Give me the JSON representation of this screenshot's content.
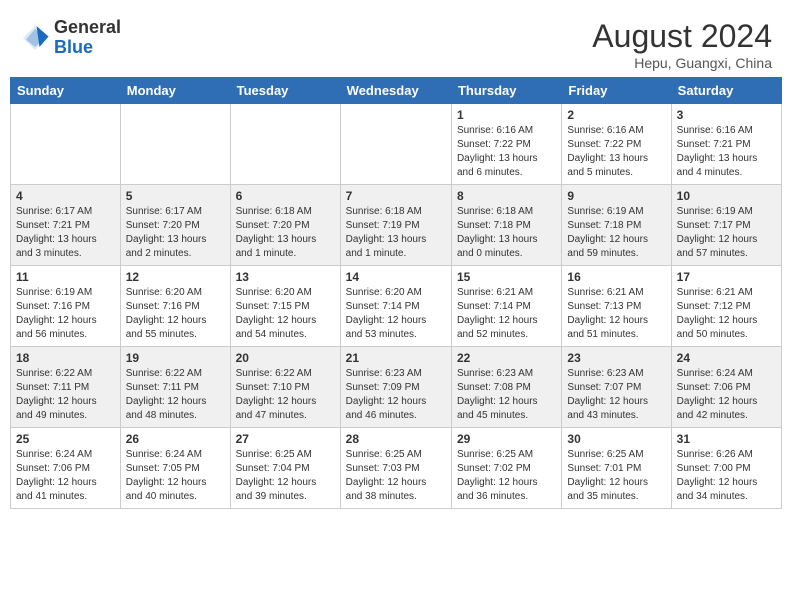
{
  "header": {
    "logo_general": "General",
    "logo_blue": "Blue",
    "month_year": "August 2024",
    "location": "Hepu, Guangxi, China"
  },
  "days_of_week": [
    "Sunday",
    "Monday",
    "Tuesday",
    "Wednesday",
    "Thursday",
    "Friday",
    "Saturday"
  ],
  "weeks": [
    [
      {
        "day": "",
        "info": ""
      },
      {
        "day": "",
        "info": ""
      },
      {
        "day": "",
        "info": ""
      },
      {
        "day": "",
        "info": ""
      },
      {
        "day": "1",
        "info": "Sunrise: 6:16 AM\nSunset: 7:22 PM\nDaylight: 13 hours\nand 6 minutes."
      },
      {
        "day": "2",
        "info": "Sunrise: 6:16 AM\nSunset: 7:22 PM\nDaylight: 13 hours\nand 5 minutes."
      },
      {
        "day": "3",
        "info": "Sunrise: 6:16 AM\nSunset: 7:21 PM\nDaylight: 13 hours\nand 4 minutes."
      }
    ],
    [
      {
        "day": "4",
        "info": "Sunrise: 6:17 AM\nSunset: 7:21 PM\nDaylight: 13 hours\nand 3 minutes."
      },
      {
        "day": "5",
        "info": "Sunrise: 6:17 AM\nSunset: 7:20 PM\nDaylight: 13 hours\nand 2 minutes."
      },
      {
        "day": "6",
        "info": "Sunrise: 6:18 AM\nSunset: 7:20 PM\nDaylight: 13 hours\nand 1 minute."
      },
      {
        "day": "7",
        "info": "Sunrise: 6:18 AM\nSunset: 7:19 PM\nDaylight: 13 hours\nand 1 minute."
      },
      {
        "day": "8",
        "info": "Sunrise: 6:18 AM\nSunset: 7:18 PM\nDaylight: 13 hours\nand 0 minutes."
      },
      {
        "day": "9",
        "info": "Sunrise: 6:19 AM\nSunset: 7:18 PM\nDaylight: 12 hours\nand 59 minutes."
      },
      {
        "day": "10",
        "info": "Sunrise: 6:19 AM\nSunset: 7:17 PM\nDaylight: 12 hours\nand 57 minutes."
      }
    ],
    [
      {
        "day": "11",
        "info": "Sunrise: 6:19 AM\nSunset: 7:16 PM\nDaylight: 12 hours\nand 56 minutes."
      },
      {
        "day": "12",
        "info": "Sunrise: 6:20 AM\nSunset: 7:16 PM\nDaylight: 12 hours\nand 55 minutes."
      },
      {
        "day": "13",
        "info": "Sunrise: 6:20 AM\nSunset: 7:15 PM\nDaylight: 12 hours\nand 54 minutes."
      },
      {
        "day": "14",
        "info": "Sunrise: 6:20 AM\nSunset: 7:14 PM\nDaylight: 12 hours\nand 53 minutes."
      },
      {
        "day": "15",
        "info": "Sunrise: 6:21 AM\nSunset: 7:14 PM\nDaylight: 12 hours\nand 52 minutes."
      },
      {
        "day": "16",
        "info": "Sunrise: 6:21 AM\nSunset: 7:13 PM\nDaylight: 12 hours\nand 51 minutes."
      },
      {
        "day": "17",
        "info": "Sunrise: 6:21 AM\nSunset: 7:12 PM\nDaylight: 12 hours\nand 50 minutes."
      }
    ],
    [
      {
        "day": "18",
        "info": "Sunrise: 6:22 AM\nSunset: 7:11 PM\nDaylight: 12 hours\nand 49 minutes."
      },
      {
        "day": "19",
        "info": "Sunrise: 6:22 AM\nSunset: 7:11 PM\nDaylight: 12 hours\nand 48 minutes."
      },
      {
        "day": "20",
        "info": "Sunrise: 6:22 AM\nSunset: 7:10 PM\nDaylight: 12 hours\nand 47 minutes."
      },
      {
        "day": "21",
        "info": "Sunrise: 6:23 AM\nSunset: 7:09 PM\nDaylight: 12 hours\nand 46 minutes."
      },
      {
        "day": "22",
        "info": "Sunrise: 6:23 AM\nSunset: 7:08 PM\nDaylight: 12 hours\nand 45 minutes."
      },
      {
        "day": "23",
        "info": "Sunrise: 6:23 AM\nSunset: 7:07 PM\nDaylight: 12 hours\nand 43 minutes."
      },
      {
        "day": "24",
        "info": "Sunrise: 6:24 AM\nSunset: 7:06 PM\nDaylight: 12 hours\nand 42 minutes."
      }
    ],
    [
      {
        "day": "25",
        "info": "Sunrise: 6:24 AM\nSunset: 7:06 PM\nDaylight: 12 hours\nand 41 minutes."
      },
      {
        "day": "26",
        "info": "Sunrise: 6:24 AM\nSunset: 7:05 PM\nDaylight: 12 hours\nand 40 minutes."
      },
      {
        "day": "27",
        "info": "Sunrise: 6:25 AM\nSunset: 7:04 PM\nDaylight: 12 hours\nand 39 minutes."
      },
      {
        "day": "28",
        "info": "Sunrise: 6:25 AM\nSunset: 7:03 PM\nDaylight: 12 hours\nand 38 minutes."
      },
      {
        "day": "29",
        "info": "Sunrise: 6:25 AM\nSunset: 7:02 PM\nDaylight: 12 hours\nand 36 minutes."
      },
      {
        "day": "30",
        "info": "Sunrise: 6:25 AM\nSunset: 7:01 PM\nDaylight: 12 hours\nand 35 minutes."
      },
      {
        "day": "31",
        "info": "Sunrise: 6:26 AM\nSunset: 7:00 PM\nDaylight: 12 hours\nand 34 minutes."
      }
    ]
  ]
}
